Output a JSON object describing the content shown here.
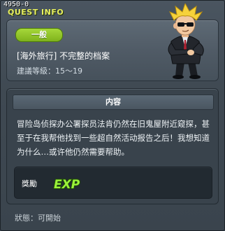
{
  "window": {
    "quest_id": "4950-0",
    "title": "QUEST INFO"
  },
  "quest": {
    "category": "一般",
    "name": "[海外旅行] 不完整的档案",
    "level_range": "建議等級：15～19"
  },
  "content": {
    "header": "内容",
    "description": "冒险岛侦探办公署探员法肯仍然在旧鬼屋附近窥探，甚至于在我帮他找到一些超自然活动报告之后！我想知道为什么…或许他仍然需要帮助。"
  },
  "reward": {
    "label": "獎勵",
    "exp_text": "EXP",
    "icon": "exp-icon"
  },
  "status": {
    "text": "狀態：可開始"
  },
  "colors": {
    "title": "#e8f060",
    "badge": "#8cc628",
    "panel": "#505b66"
  }
}
